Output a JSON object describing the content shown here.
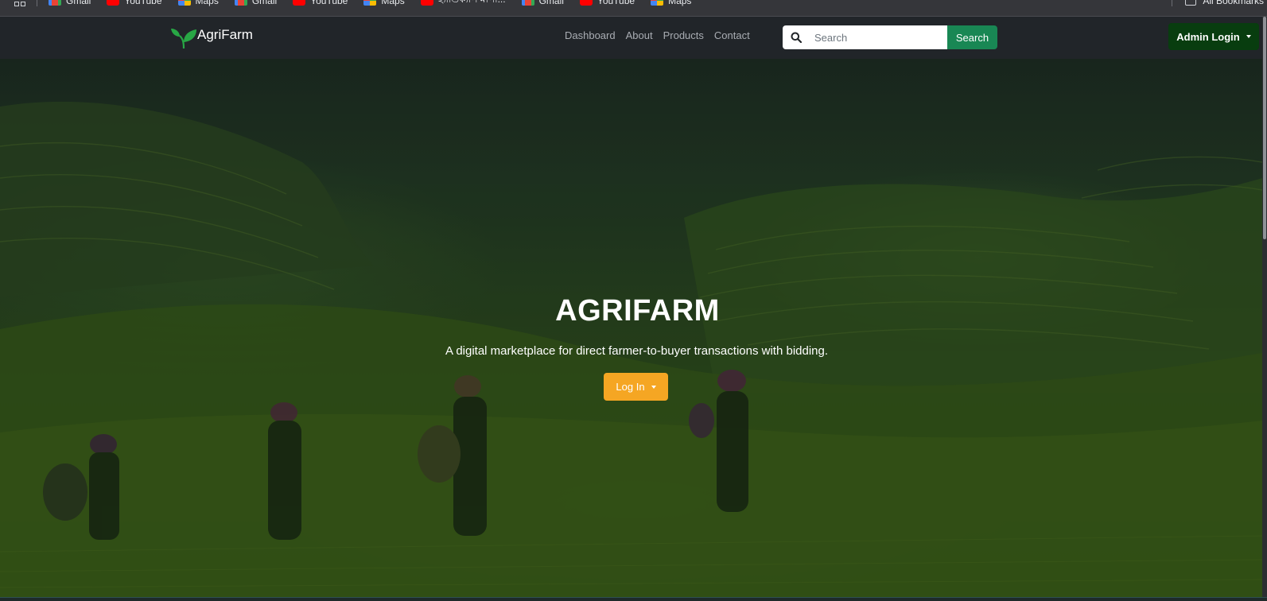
{
  "bookmarks": {
    "items": [
      {
        "label": "Gmail",
        "icon": "gmail-icon"
      },
      {
        "label": "YouTube",
        "icon": "youtube-icon"
      },
      {
        "label": "Maps",
        "icon": "maps-icon"
      },
      {
        "label": "Gmail",
        "icon": "gmail-icon"
      },
      {
        "label": "YouTube",
        "icon": "youtube-icon"
      },
      {
        "label": "Maps",
        "icon": "maps-icon"
      },
      {
        "label": "হ্যান্ডিক্যাপ মাপা...",
        "icon": "youtube-icon"
      },
      {
        "label": "Gmail",
        "icon": "gmail-icon"
      },
      {
        "label": "YouTube",
        "icon": "youtube-icon"
      },
      {
        "label": "Maps",
        "icon": "maps-icon"
      }
    ],
    "all_bookmarks_label": "All Bookmarks"
  },
  "navbar": {
    "brand": "AgriFarm",
    "links": [
      "Dashboard",
      "About",
      "Products",
      "Contact"
    ],
    "search_placeholder": "Search",
    "search_button": "Search",
    "admin_button": "Admin Login"
  },
  "hero": {
    "title": "AGRIFARM",
    "subtitle": "A digital marketplace for direct farmer-to-buyer transactions with bidding.",
    "login_button": "Log In"
  },
  "colors": {
    "navbar_bg": "#212529",
    "search_button": "#198754",
    "admin_button": "#083d0f",
    "login_button": "#f5a623",
    "brand_leaf": "#28a745"
  }
}
